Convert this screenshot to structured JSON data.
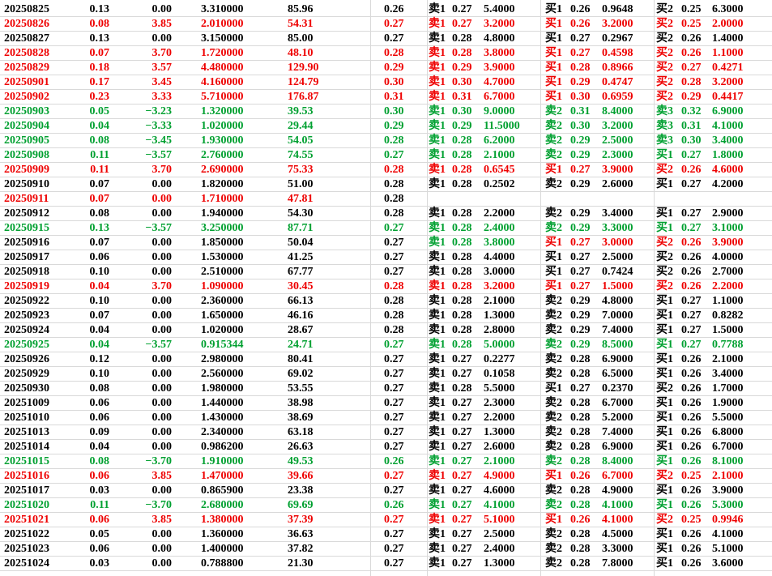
{
  "sheet": {
    "rows": [
      {
        "date": "20250825",
        "c": "black",
        "v1": "0.13",
        "v2": "0.00",
        "v3": "3.310000",
        "v4": "85.96",
        "v5": "0.26",
        "o1": "卖1",
        "p1": "0.27",
        "q1": "5.4000",
        "o1c": "black",
        "o2": "买1",
        "p2": "0.26",
        "q2": "0.9648",
        "o2c": "black",
        "o3": "买2",
        "p3": "0.25",
        "q3": "6.3000",
        "o3c": "black"
      },
      {
        "date": "20250826",
        "c": "red",
        "v1": "0.08",
        "v2": "3.85",
        "v3": "2.010000",
        "v4": "54.31",
        "v5": "0.27",
        "o1": "卖1",
        "p1": "0.27",
        "q1": "3.2000",
        "o1c": "red",
        "o2": "买1",
        "p2": "0.26",
        "q2": "3.2000",
        "o2c": "red",
        "o3": "买2",
        "p3": "0.25",
        "q3": "2.0000",
        "o3c": "red"
      },
      {
        "date": "20250827",
        "c": "black",
        "v1": "0.13",
        "v2": "0.00",
        "v3": "3.150000",
        "v4": "85.00",
        "v5": "0.27",
        "o1": "卖1",
        "p1": "0.28",
        "q1": "4.8000",
        "o1c": "black",
        "o2": "买1",
        "p2": "0.27",
        "q2": "0.2967",
        "o2c": "black",
        "o3": "买2",
        "p3": "0.26",
        "q3": "1.4000",
        "o3c": "black"
      },
      {
        "date": "20250828",
        "c": "red",
        "v1": "0.07",
        "v2": "3.70",
        "v3": "1.720000",
        "v4": "48.10",
        "v5": "0.28",
        "o1": "卖1",
        "p1": "0.28",
        "q1": "3.8000",
        "o1c": "red",
        "o2": "买1",
        "p2": "0.27",
        "q2": "0.4598",
        "o2c": "red",
        "o3": "买2",
        "p3": "0.26",
        "q3": "1.1000",
        "o3c": "red"
      },
      {
        "date": "20250829",
        "c": "red",
        "v1": "0.18",
        "v2": "3.57",
        "v3": "4.480000",
        "v4": "129.90",
        "v5": "0.29",
        "o1": "卖1",
        "p1": "0.29",
        "q1": "3.9000",
        "o1c": "red",
        "o2": "买1",
        "p2": "0.28",
        "q2": "0.8966",
        "o2c": "red",
        "o3": "买2",
        "p3": "0.27",
        "q3": "0.4271",
        "o3c": "red"
      },
      {
        "date": "20250901",
        "c": "red",
        "v1": "0.17",
        "v2": "3.45",
        "v3": "4.160000",
        "v4": "124.79",
        "v5": "0.30",
        "o1": "卖1",
        "p1": "0.30",
        "q1": "4.7000",
        "o1c": "red",
        "o2": "买1",
        "p2": "0.29",
        "q2": "0.4747",
        "o2c": "red",
        "o3": "买2",
        "p3": "0.28",
        "q3": "3.2000",
        "o3c": "red"
      },
      {
        "date": "20250902",
        "c": "red",
        "v1": "0.23",
        "v2": "3.33",
        "v3": "5.710000",
        "v4": "176.87",
        "v5": "0.31",
        "o1": "卖1",
        "p1": "0.31",
        "q1": "6.7000",
        "o1c": "red",
        "o2": "买1",
        "p2": "0.30",
        "q2": "0.6959",
        "o2c": "red",
        "o3": "买2",
        "p3": "0.29",
        "q3": "0.4417",
        "o3c": "red"
      },
      {
        "date": "20250903",
        "c": "green",
        "v1": "0.05",
        "v2": "−3.23",
        "v3": "1.320000",
        "v4": "39.53",
        "v5": "0.30",
        "o1": "卖1",
        "p1": "0.30",
        "q1": "9.0000",
        "o1c": "green",
        "o2": "卖2",
        "p2": "0.31",
        "q2": "8.4000",
        "o2c": "green",
        "o3": "卖3",
        "p3": "0.32",
        "q3": "6.9000",
        "o3c": "green"
      },
      {
        "date": "20250904",
        "c": "green",
        "v1": "0.04",
        "v2": "−3.33",
        "v3": "1.020000",
        "v4": "29.44",
        "v5": "0.29",
        "o1": "卖1",
        "p1": "0.29",
        "q1": "11.5000",
        "o1c": "green",
        "o2": "卖2",
        "p2": "0.30",
        "q2": "3.2000",
        "o2c": "green",
        "o3": "卖3",
        "p3": "0.31",
        "q3": "4.1000",
        "o3c": "green"
      },
      {
        "date": "20250905",
        "c": "green",
        "v1": "0.08",
        "v2": "−3.45",
        "v3": "1.930000",
        "v4": "54.05",
        "v5": "0.28",
        "o1": "卖1",
        "p1": "0.28",
        "q1": "6.2000",
        "o1c": "green",
        "o2": "卖2",
        "p2": "0.29",
        "q2": "2.5000",
        "o2c": "green",
        "o3": "卖3",
        "p3": "0.30",
        "q3": "3.4000",
        "o3c": "green"
      },
      {
        "date": "20250908",
        "c": "green",
        "v1": "0.11",
        "v2": "−3.57",
        "v3": "2.760000",
        "v4": "74.55",
        "v5": "0.27",
        "o1": "卖1",
        "p1": "0.28",
        "q1": "2.1000",
        "o1c": "green",
        "o2": "卖2",
        "p2": "0.29",
        "q2": "2.3000",
        "o2c": "green",
        "o3": "买1",
        "p3": "0.27",
        "q3": "1.8000",
        "o3c": "green"
      },
      {
        "date": "20250909",
        "c": "red",
        "v1": "0.11",
        "v2": "3.70",
        "v3": "2.690000",
        "v4": "75.33",
        "v5": "0.28",
        "o1": "卖1",
        "p1": "0.28",
        "q1": "0.6545",
        "o1c": "red",
        "o2": "买1",
        "p2": "0.27",
        "q2": "3.9000",
        "o2c": "red",
        "o3": "买2",
        "p3": "0.26",
        "q3": "4.6000",
        "o3c": "red"
      },
      {
        "date": "20250910",
        "c": "black",
        "v1": "0.07",
        "v2": "0.00",
        "v3": "1.820000",
        "v4": "51.00",
        "v5": "0.28",
        "o1": "卖1",
        "p1": "0.28",
        "q1": "0.2502",
        "o1c": "black",
        "o2": "卖2",
        "p2": "0.29",
        "q2": "2.6000",
        "o2c": "black",
        "o3": "买1",
        "p3": "0.27",
        "q3": "4.2000",
        "o3c": "black"
      },
      {
        "date": "20250911",
        "c": "red",
        "v1": "0.07",
        "v2": "0.00",
        "v3": "1.710000",
        "v4": "47.81",
        "v5": "0.28",
        "o1": "",
        "p1": "",
        "q1": "",
        "o1c": "black",
        "o2": "",
        "p2": "",
        "q2": "",
        "o2c": "black",
        "o3": "",
        "p3": "",
        "q3": "",
        "o3c": "black",
        "rest": "black"
      },
      {
        "date": "20250912",
        "c": "black",
        "v1": "0.08",
        "v2": "0.00",
        "v3": "1.940000",
        "v4": "54.30",
        "v5": "0.28",
        "o1": "卖1",
        "p1": "0.28",
        "q1": "2.2000",
        "o1c": "black",
        "o2": "卖2",
        "p2": "0.29",
        "q2": "3.4000",
        "o2c": "black",
        "o3": "买1",
        "p3": "0.27",
        "q3": "2.9000",
        "o3c": "black"
      },
      {
        "date": "20250915",
        "c": "green",
        "v1": "0.13",
        "v2": "−3.57",
        "v3": "3.250000",
        "v4": "87.71",
        "v5": "0.27",
        "o1": "卖1",
        "p1": "0.28",
        "q1": "2.4000",
        "o1c": "green",
        "o2": "卖2",
        "p2": "0.29",
        "q2": "3.3000",
        "o2c": "green",
        "o3": "买1",
        "p3": "0.27",
        "q3": "3.1000",
        "o3c": "green"
      },
      {
        "date": "20250916",
        "c": "black",
        "v1": "0.07",
        "v2": "0.00",
        "v3": "1.850000",
        "v4": "50.04",
        "v5": "0.27",
        "o1": "卖1",
        "p1": "0.28",
        "q1": "3.8000",
        "o1c": "green",
        "o2": "买1",
        "p2": "0.27",
        "q2": "3.0000",
        "o2c": "red",
        "o3": "买2",
        "p3": "0.26",
        "q3": "3.9000",
        "o3c": "red"
      },
      {
        "date": "20250917",
        "c": "black",
        "v1": "0.06",
        "v2": "0.00",
        "v3": "1.530000",
        "v4": "41.25",
        "v5": "0.27",
        "o1": "卖1",
        "p1": "0.28",
        "q1": "4.4000",
        "o1c": "black",
        "o2": "买1",
        "p2": "0.27",
        "q2": "2.5000",
        "o2c": "black",
        "o3": "买2",
        "p3": "0.26",
        "q3": "4.0000",
        "o3c": "black"
      },
      {
        "date": "20250918",
        "c": "black",
        "v1": "0.10",
        "v2": "0.00",
        "v3": "2.510000",
        "v4": "67.77",
        "v5": "0.27",
        "o1": "卖1",
        "p1": "0.28",
        "q1": "3.0000",
        "o1c": "black",
        "o2": "买1",
        "p2": "0.27",
        "q2": "0.7424",
        "o2c": "black",
        "o3": "买2",
        "p3": "0.26",
        "q3": "2.7000",
        "o3c": "black"
      },
      {
        "date": "20250919",
        "c": "red",
        "v1": "0.04",
        "v2": "3.70",
        "v3": "1.090000",
        "v4": "30.45",
        "v5": "0.28",
        "o1": "卖1",
        "p1": "0.28",
        "q1": "3.2000",
        "o1c": "red",
        "o2": "买1",
        "p2": "0.27",
        "q2": "1.5000",
        "o2c": "red",
        "o3": "买2",
        "p3": "0.26",
        "q3": "2.2000",
        "o3c": "red"
      },
      {
        "date": "20250922",
        "c": "black",
        "v1": "0.10",
        "v2": "0.00",
        "v3": "2.360000",
        "v4": "66.13",
        "v5": "0.28",
        "o1": "卖1",
        "p1": "0.28",
        "q1": "2.1000",
        "o1c": "black",
        "o2": "卖2",
        "p2": "0.29",
        "q2": "4.8000",
        "o2c": "black",
        "o3": "买1",
        "p3": "0.27",
        "q3": "1.1000",
        "o3c": "black"
      },
      {
        "date": "20250923",
        "c": "black",
        "v1": "0.07",
        "v2": "0.00",
        "v3": "1.650000",
        "v4": "46.16",
        "v5": "0.28",
        "o1": "卖1",
        "p1": "0.28",
        "q1": "1.3000",
        "o1c": "black",
        "o2": "卖2",
        "p2": "0.29",
        "q2": "7.0000",
        "o2c": "black",
        "o3": "买1",
        "p3": "0.27",
        "q3": "0.8282",
        "o3c": "black"
      },
      {
        "date": "20250924",
        "c": "black",
        "v1": "0.04",
        "v2": "0.00",
        "v3": "1.020000",
        "v4": "28.67",
        "v5": "0.28",
        "o1": "卖1",
        "p1": "0.28",
        "q1": "2.8000",
        "o1c": "black",
        "o2": "卖2",
        "p2": "0.29",
        "q2": "7.4000",
        "o2c": "black",
        "o3": "买1",
        "p3": "0.27",
        "q3": "1.5000",
        "o3c": "black"
      },
      {
        "date": "20250925",
        "c": "green",
        "v1": "0.04",
        "v2": "−3.57",
        "v3": "0.915344",
        "v4": "24.71",
        "v5": "0.27",
        "o1": "卖1",
        "p1": "0.28",
        "q1": "5.0000",
        "o1c": "green",
        "o2": "卖2",
        "p2": "0.29",
        "q2": "8.5000",
        "o2c": "green",
        "o3": "买1",
        "p3": "0.27",
        "q3": "0.7788",
        "o3c": "green"
      },
      {
        "date": "20250926",
        "c": "black",
        "v1": "0.12",
        "v2": "0.00",
        "v3": "2.980000",
        "v4": "80.41",
        "v5": "0.27",
        "o1": "卖1",
        "p1": "0.27",
        "q1": "0.2277",
        "o1c": "black",
        "o2": "卖2",
        "p2": "0.28",
        "q2": "6.9000",
        "o2c": "black",
        "o3": "买1",
        "p3": "0.26",
        "q3": "2.1000",
        "o3c": "black"
      },
      {
        "date": "20250929",
        "c": "black",
        "v1": "0.10",
        "v2": "0.00",
        "v3": "2.560000",
        "v4": "69.02",
        "v5": "0.27",
        "o1": "卖1",
        "p1": "0.27",
        "q1": "0.1058",
        "o1c": "black",
        "o2": "卖2",
        "p2": "0.28",
        "q2": "6.5000",
        "o2c": "black",
        "o3": "买1",
        "p3": "0.26",
        "q3": "3.4000",
        "o3c": "black"
      },
      {
        "date": "20250930",
        "c": "black",
        "v1": "0.08",
        "v2": "0.00",
        "v3": "1.980000",
        "v4": "53.55",
        "v5": "0.27",
        "o1": "卖1",
        "p1": "0.28",
        "q1": "5.5000",
        "o1c": "black",
        "o2": "买1",
        "p2": "0.27",
        "q2": "0.2370",
        "o2c": "black",
        "o3": "买2",
        "p3": "0.26",
        "q3": "1.7000",
        "o3c": "black"
      },
      {
        "date": "20251009",
        "c": "black",
        "v1": "0.06",
        "v2": "0.00",
        "v3": "1.440000",
        "v4": "38.98",
        "v5": "0.27",
        "o1": "卖1",
        "p1": "0.27",
        "q1": "2.3000",
        "o1c": "black",
        "o2": "卖2",
        "p2": "0.28",
        "q2": "6.7000",
        "o2c": "black",
        "o3": "买1",
        "p3": "0.26",
        "q3": "1.9000",
        "o3c": "black"
      },
      {
        "date": "20251010",
        "c": "black",
        "v1": "0.06",
        "v2": "0.00",
        "v3": "1.430000",
        "v4": "38.69",
        "v5": "0.27",
        "o1": "卖1",
        "p1": "0.27",
        "q1": "2.2000",
        "o1c": "black",
        "o2": "卖2",
        "p2": "0.28",
        "q2": "5.2000",
        "o2c": "black",
        "o3": "买1",
        "p3": "0.26",
        "q3": "5.5000",
        "o3c": "black"
      },
      {
        "date": "20251013",
        "c": "black",
        "v1": "0.09",
        "v2": "0.00",
        "v3": "2.340000",
        "v4": "63.18",
        "v5": "0.27",
        "o1": "卖1",
        "p1": "0.27",
        "q1": "1.3000",
        "o1c": "black",
        "o2": "卖2",
        "p2": "0.28",
        "q2": "7.4000",
        "o2c": "black",
        "o3": "买1",
        "p3": "0.26",
        "q3": "6.8000",
        "o3c": "black"
      },
      {
        "date": "20251014",
        "c": "black",
        "v1": "0.04",
        "v2": "0.00",
        "v3": "0.986200",
        "v4": "26.63",
        "v5": "0.27",
        "o1": "卖1",
        "p1": "0.27",
        "q1": "2.6000",
        "o1c": "black",
        "o2": "卖2",
        "p2": "0.28",
        "q2": "6.9000",
        "o2c": "black",
        "o3": "买1",
        "p3": "0.26",
        "q3": "6.7000",
        "o3c": "black"
      },
      {
        "date": "20251015",
        "c": "green",
        "v1": "0.08",
        "v2": "−3.70",
        "v3": "1.910000",
        "v4": "49.53",
        "v5": "0.26",
        "o1": "卖1",
        "p1": "0.27",
        "q1": "2.1000",
        "o1c": "green",
        "o2": "卖2",
        "p2": "0.28",
        "q2": "8.4000",
        "o2c": "green",
        "o3": "买1",
        "p3": "0.26",
        "q3": "8.1000",
        "o3c": "green"
      },
      {
        "date": "20251016",
        "c": "red",
        "v1": "0.06",
        "v2": "3.85",
        "v3": "1.470000",
        "v4": "39.66",
        "v5": "0.27",
        "o1": "卖1",
        "p1": "0.27",
        "q1": "4.9000",
        "o1c": "red",
        "o2": "买1",
        "p2": "0.26",
        "q2": "6.7000",
        "o2c": "red",
        "o3": "买2",
        "p3": "0.25",
        "q3": "2.1000",
        "o3c": "red"
      },
      {
        "date": "20251017",
        "c": "black",
        "v1": "0.03",
        "v2": "0.00",
        "v3": "0.865900",
        "v4": "23.38",
        "v5": "0.27",
        "o1": "卖1",
        "p1": "0.27",
        "q1": "4.6000",
        "o1c": "black",
        "o2": "卖2",
        "p2": "0.28",
        "q2": "4.9000",
        "o2c": "black",
        "o3": "买1",
        "p3": "0.26",
        "q3": "3.9000",
        "o3c": "black"
      },
      {
        "date": "20251020",
        "c": "green",
        "v1": "0.11",
        "v2": "−3.70",
        "v3": "2.680000",
        "v4": "69.69",
        "v5": "0.26",
        "o1": "卖1",
        "p1": "0.27",
        "q1": "4.1000",
        "o1c": "green",
        "o2": "卖2",
        "p2": "0.28",
        "q2": "4.1000",
        "o2c": "green",
        "o3": "买1",
        "p3": "0.26",
        "q3": "5.3000",
        "o3c": "green"
      },
      {
        "date": "20251021",
        "c": "red",
        "v1": "0.06",
        "v2": "3.85",
        "v3": "1.380000",
        "v4": "37.39",
        "v5": "0.27",
        "o1": "卖1",
        "p1": "0.27",
        "q1": "5.1000",
        "o1c": "red",
        "o2": "买1",
        "p2": "0.26",
        "q2": "4.1000",
        "o2c": "red",
        "o3": "买2",
        "p3": "0.25",
        "q3": "0.9946",
        "o3c": "red"
      },
      {
        "date": "20251022",
        "c": "black",
        "v1": "0.05",
        "v2": "0.00",
        "v3": "1.360000",
        "v4": "36.63",
        "v5": "0.27",
        "o1": "卖1",
        "p1": "0.27",
        "q1": "2.5000",
        "o1c": "black",
        "o2": "卖2",
        "p2": "0.28",
        "q2": "4.5000",
        "o2c": "black",
        "o3": "买1",
        "p3": "0.26",
        "q3": "4.1000",
        "o3c": "black"
      },
      {
        "date": "20251023",
        "c": "black",
        "v1": "0.06",
        "v2": "0.00",
        "v3": "1.400000",
        "v4": "37.82",
        "v5": "0.27",
        "o1": "卖1",
        "p1": "0.27",
        "q1": "2.4000",
        "o1c": "black",
        "o2": "卖2",
        "p2": "0.28",
        "q2": "3.3000",
        "o2c": "black",
        "o3": "买1",
        "p3": "0.26",
        "q3": "5.1000",
        "o3c": "black"
      },
      {
        "date": "20251024",
        "c": "black",
        "v1": "0.03",
        "v2": "0.00",
        "v3": "0.788800",
        "v4": "21.30",
        "v5": "0.27",
        "o1": "卖1",
        "p1": "0.27",
        "q1": "1.3000",
        "o1c": "black",
        "o2": "卖2",
        "p2": "0.28",
        "q2": "7.8000",
        "o2c": "black",
        "o3": "买1",
        "p3": "0.26",
        "q3": "3.6000",
        "o3c": "black"
      }
    ]
  }
}
